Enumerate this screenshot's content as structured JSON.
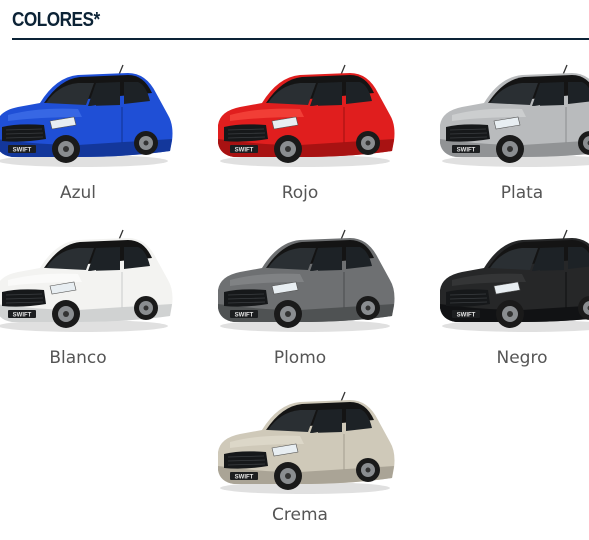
{
  "section": {
    "title": "COLORES*"
  },
  "colors": [
    {
      "name": "Azul",
      "body": "#1f4fd6",
      "shade": "#123391",
      "light": "#4a7bf0"
    },
    {
      "name": "Rojo",
      "body": "#e01e1e",
      "shade": "#9e1010",
      "light": "#ff5a4a"
    },
    {
      "name": "Plata",
      "body": "#b9bbbd",
      "shade": "#8a8c8e",
      "light": "#dcdedf"
    },
    {
      "name": "Blanco",
      "body": "#f3f3f1",
      "shade": "#c9cbcc",
      "light": "#ffffff"
    },
    {
      "name": "Plomo",
      "body": "#6e7072",
      "shade": "#4a4c4e",
      "light": "#8f9193"
    },
    {
      "name": "Negro",
      "body": "#262728",
      "shade": "#0e0f10",
      "light": "#3f4142"
    },
    {
      "name": "Crema",
      "body": "#cfc9b9",
      "shade": "#a39d8f",
      "light": "#e7e2d6"
    }
  ],
  "badge_text": "SWIFT"
}
